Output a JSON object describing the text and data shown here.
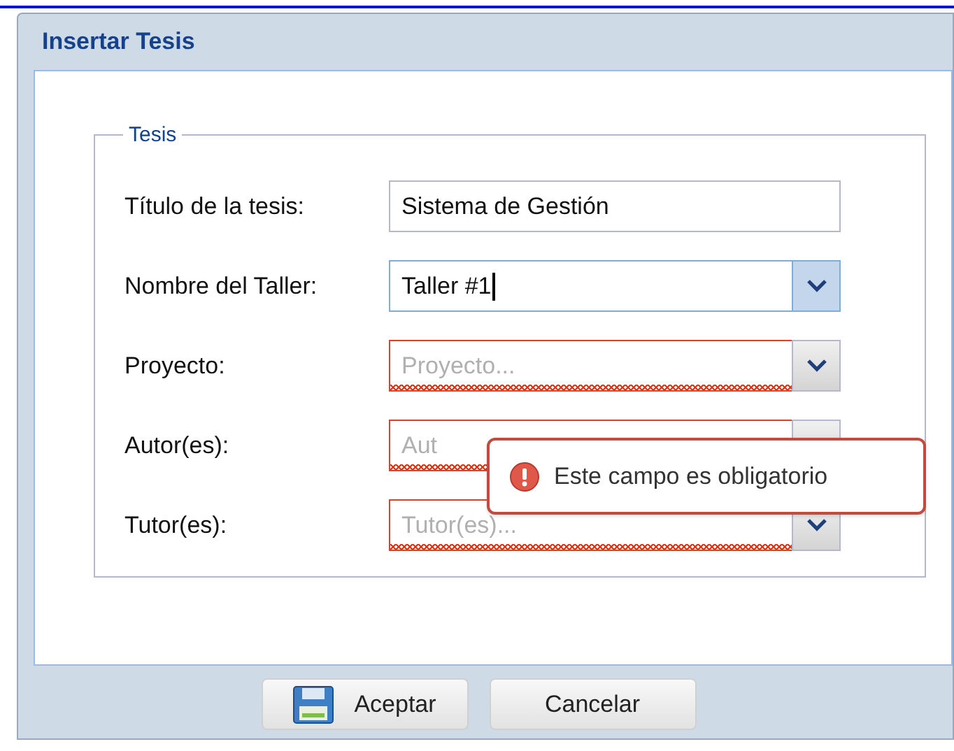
{
  "window": {
    "title": "Insertar Tesis"
  },
  "fieldset": {
    "legend": "Tesis"
  },
  "fields": [
    {
      "label": "Título de la tesis:",
      "kind": "text",
      "value": "Sistema de Gestión",
      "invalid": false,
      "focused": false
    },
    {
      "label": "Nombre del Taller:",
      "kind": "combo",
      "value": "Taller #1",
      "invalid": false,
      "focused": true,
      "chevron": true
    },
    {
      "label": "Proyecto:",
      "kind": "combo",
      "placeholder": "Proyecto...",
      "invalid": true,
      "focused": false,
      "chevron": true
    },
    {
      "label": "Autor(es):",
      "kind": "combo",
      "placeholder": "Aut",
      "invalid": true,
      "focused": false,
      "chevron": false
    },
    {
      "label": "Tutor(es):",
      "kind": "combo",
      "placeholder": "Tutor(es)...",
      "invalid": true,
      "focused": false,
      "chevron": true
    }
  ],
  "tooltip": {
    "text": "Este campo es obligatorio"
  },
  "buttons": [
    {
      "label": "Aceptar",
      "kind": "save"
    },
    {
      "label": "Cancelar",
      "kind": "plain"
    }
  ]
}
